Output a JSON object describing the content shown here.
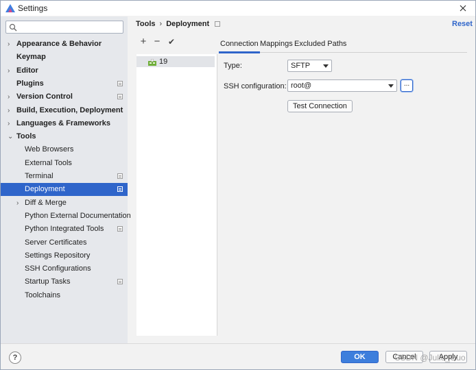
{
  "window": {
    "title": "Settings"
  },
  "search": {
    "placeholder": ""
  },
  "sidebar": {
    "items": [
      {
        "label": "Appearance & Behavior",
        "bold": true,
        "arrow": "›",
        "indent": 0
      },
      {
        "label": "Keymap",
        "bold": true,
        "arrow": "",
        "indent": 0
      },
      {
        "label": "Editor",
        "bold": true,
        "arrow": "›",
        "indent": 0
      },
      {
        "label": "Plugins",
        "bold": true,
        "arrow": "",
        "indent": 0,
        "pageIcon": true
      },
      {
        "label": "Version Control",
        "bold": true,
        "arrow": "›",
        "indent": 0,
        "pageIcon": true
      },
      {
        "label": "Build, Execution, Deployment",
        "bold": true,
        "arrow": "›",
        "indent": 0
      },
      {
        "label": "Languages & Frameworks",
        "bold": true,
        "arrow": "›",
        "indent": 0
      },
      {
        "label": "Tools",
        "bold": true,
        "arrow": "⌄",
        "indent": 0
      },
      {
        "label": "Web Browsers",
        "bold": false,
        "arrow": "",
        "indent": 1
      },
      {
        "label": "External Tools",
        "bold": false,
        "arrow": "",
        "indent": 1
      },
      {
        "label": "Terminal",
        "bold": false,
        "arrow": "",
        "indent": 1,
        "pageIcon": true
      },
      {
        "label": "Deployment",
        "bold": false,
        "arrow": "",
        "indent": 1,
        "pageIcon": true,
        "selected": true
      },
      {
        "label": "Diff & Merge",
        "bold": false,
        "arrow": "›",
        "indent": 1
      },
      {
        "label": "Python External Documentation",
        "bold": false,
        "arrow": "",
        "indent": 1
      },
      {
        "label": "Python Integrated Tools",
        "bold": false,
        "arrow": "",
        "indent": 1,
        "pageIcon": true
      },
      {
        "label": "Server Certificates",
        "bold": false,
        "arrow": "",
        "indent": 1
      },
      {
        "label": "Settings Repository",
        "bold": false,
        "arrow": "",
        "indent": 1
      },
      {
        "label": "SSH Configurations",
        "bold": false,
        "arrow": "",
        "indent": 1
      },
      {
        "label": "Startup Tasks",
        "bold": false,
        "arrow": "",
        "indent": 1,
        "pageIcon": true
      },
      {
        "label": "Toolchains",
        "bold": false,
        "arrow": "",
        "indent": 1
      }
    ]
  },
  "header": {
    "crumb1": "Tools",
    "separator": "›",
    "crumb2": "Deployment",
    "reset": "Reset"
  },
  "toolbar": {
    "add": "+",
    "remove": "−",
    "check": "✔"
  },
  "servers": [
    {
      "name": "19"
    }
  ],
  "tabs": [
    {
      "label": "Connection",
      "active": true
    },
    {
      "label": "Mappings",
      "active": false
    },
    {
      "label": "Excluded Paths",
      "active": false
    }
  ],
  "form": {
    "type_label": "Type:",
    "type_value": "SFTP",
    "ssh_label": "SSH configuration:",
    "ssh_value": "root@",
    "browse": "...",
    "test_connection": "Test Connection"
  },
  "footer": {
    "help": "?",
    "ok": "OK",
    "cancel": "Cancel",
    "apply": "Apply",
    "watermark": "CSDN @Julie_Guo"
  },
  "colors": {
    "accent": "#2f65ca",
    "selection": "#2f65ca",
    "sidebar_bg": "#e6e8ec",
    "panel_bg": "#f2f2f2"
  }
}
